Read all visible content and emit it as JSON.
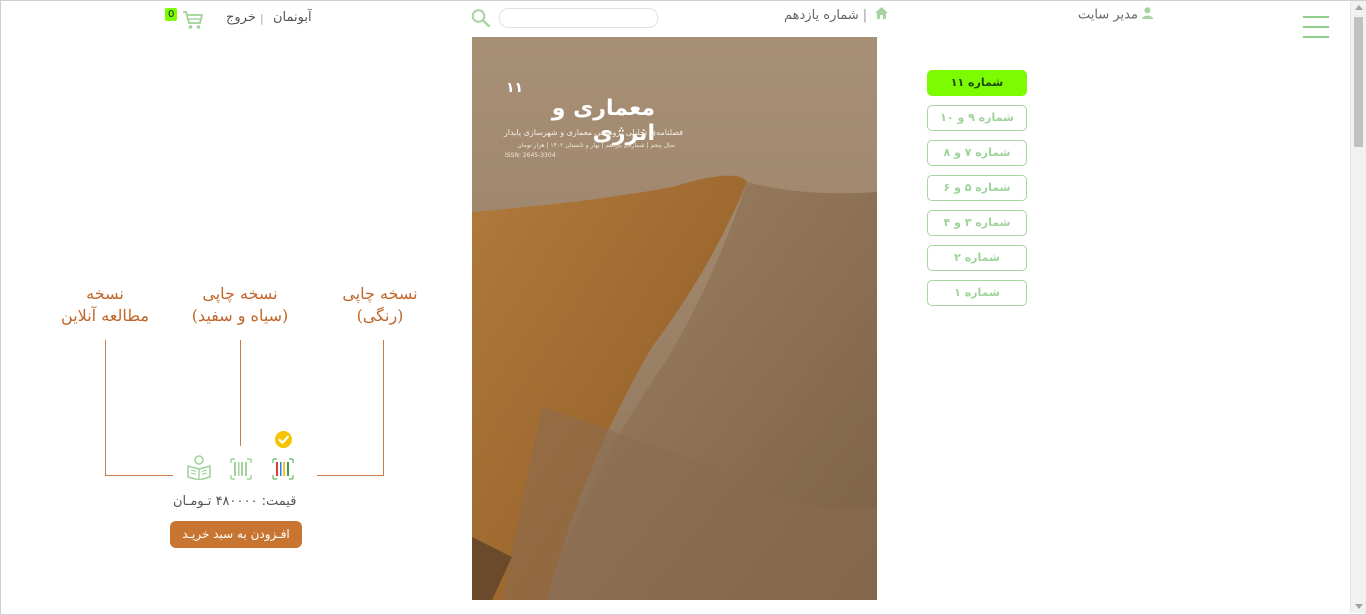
{
  "header": {
    "admin_label": "مدیر سایت",
    "breadcrumb_current": "شماره یازدهم",
    "breadcrumb_sep": "|",
    "search": {
      "placeholder": ""
    },
    "cart_count": "0",
    "logout_label": "خروج",
    "divider": "|",
    "subscription_label": "آبونمان"
  },
  "cover": {
    "number": "۱۱",
    "title": "معماری و انرژی",
    "subtitle": "فصلنامه‌ی تحلیلی پژوهشی معماری و شهرسازی پایدار",
    "meta": "سال پنجم | شماره‌ی یازدهم | بهار و تابستان ۱۴۰۲ | هزار تومان",
    "issn": "ISSN: 2645-3304"
  },
  "issues": [
    {
      "label": "شماره ۱۱",
      "active": true
    },
    {
      "label": "شماره ۹ و ۱۰",
      "active": false
    },
    {
      "label": "شماره ۷ و ۸",
      "active": false
    },
    {
      "label": "شماره ۵ و ۶",
      "active": false
    },
    {
      "label": "شماره ۳ و ۴",
      "active": false
    },
    {
      "label": "شماره ۲",
      "active": false
    },
    {
      "label": "شماره ۱",
      "active": false
    }
  ],
  "options": {
    "color": {
      "line1": "نسخه چاپی",
      "line2": "(رنگی)"
    },
    "bw": {
      "line1": "نسخه چاپی",
      "line2": "(سیاه و سفید)"
    },
    "online": {
      "line1": "نسخه",
      "line2": "مطالعه آنلاین"
    }
  },
  "price": {
    "label": "قیمت:",
    "value": "۴۸۰۰۰۰",
    "currency": "تـومـان"
  },
  "add_to_cart": "افـزودن به سبد خریـد",
  "colors": {
    "accent_green": "#7cfc00",
    "label_orange": "#c1662a",
    "button_brown": "#c87532"
  }
}
